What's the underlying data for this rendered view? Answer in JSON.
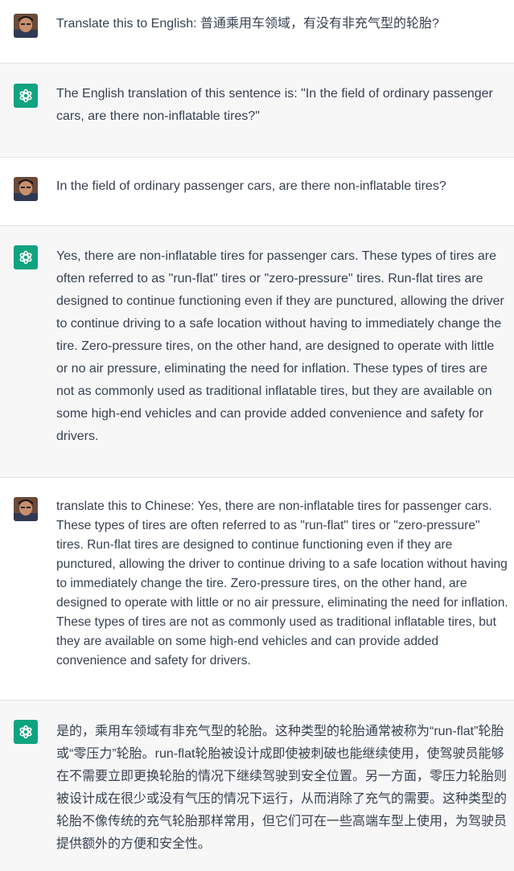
{
  "messages": [
    {
      "role": "user",
      "text": "Translate this to English: 普通乘用车领域，有没有非充气型的轮胎?"
    },
    {
      "role": "assistant",
      "text": "The English translation of this sentence is: \"In the field of ordinary passenger cars, are there non-inflatable tires?\""
    },
    {
      "role": "user",
      "text": "In the field of ordinary passenger cars, are there non-inflatable tires?"
    },
    {
      "role": "assistant",
      "text": "Yes, there are non-inflatable tires for passenger cars. These types of tires are often referred to as \"run-flat\" tires or \"zero-pressure\" tires. Run-flat tires are designed to continue functioning even if they are punctured, allowing the driver to continue driving to a safe location without having to immediately change the tire. Zero-pressure tires, on the other hand, are designed to operate with little or no air pressure, eliminating the need for inflation. These types of tires are not as commonly used as traditional inflatable tires, but they are available on some high-end vehicles and can provide added convenience and safety for drivers."
    },
    {
      "role": "user",
      "text": "translate this to Chinese: Yes, there are non-inflatable tires for passenger cars. These types of tires are often referred to as \"run-flat\" tires or \"zero-pressure\" tires. Run-flat tires are designed to continue functioning even if they are punctured, allowing the driver to continue driving to a safe location without having to immediately change the tire. Zero-pressure tires, on the other hand, are designed to operate with little or no air pressure, eliminating the need for inflation. These types of tires are not as commonly used as traditional inflatable tires, but they are available on some high-end vehicles and can provide added convenience and safety for drivers."
    },
    {
      "role": "assistant",
      "text": "是的，乘用车领域有非充气型的轮胎。这种类型的轮胎通常被称为“run-flat”轮胎或“零压力”轮胎。run-flat轮胎被设计成即使被刺破也能继续使用，使驾驶员能够在不需要立即更换轮胎的情况下继续驾驶到安全位置。另一方面，零压力轮胎则被设计成在很少或没有气压的情况下运行，从而消除了充气的需要。这种类型的轮胎不像传统的充气轮胎那样常用，但它们可在一些高端车型上使用，为驾驶员提供额外的方便和安全性。"
    }
  ],
  "icons": {
    "user_avatar": "user-avatar-icon",
    "assistant_avatar": "openai-logo-icon"
  },
  "colors": {
    "assistant_bg": "#f7f7f8",
    "user_bg": "#ffffff",
    "brand": "#10a37f",
    "text": "#374151"
  }
}
